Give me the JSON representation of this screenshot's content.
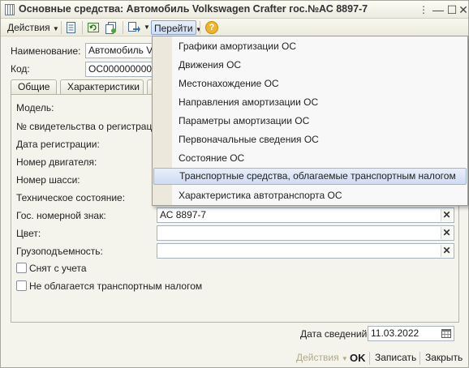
{
  "window": {
    "title": "Основные средства: Автомобиль Volkswagen Crafter гос.№АС 8897-7",
    "minimize": "—",
    "maximize": "☐",
    "close": "✕"
  },
  "toolbar": {
    "actions_label": "Действия",
    "goto_label": "Перейти",
    "help_icon": "?"
  },
  "header": {
    "name_label": "Наименование:",
    "name_value": "Автомобиль Vo",
    "code_label": "Код:",
    "code_value": "ОС00000000007"
  },
  "tabs": [
    "Общие",
    "Характеристики"
  ],
  "form": {
    "model_label": "Модель:",
    "certificate_label": "№ свидетельства о регистрации",
    "reg_date_label": "Дата регистрации:",
    "engine_label": "Номер двигателя:",
    "chassis_label": "Номер шасси:",
    "condition_label": "Техническое состояние:",
    "plate_label": "Гос. номерной знак:",
    "plate_value": "АС 8897-7",
    "color_label": "Цвет:",
    "color_value": "",
    "capacity_label": "Грузоподъемность:",
    "capacity_value": "",
    "deregistered_label": "Снят с учета",
    "no_tax_label": "Не облагается транспортным налогом",
    "clear_symbol": "✕"
  },
  "info_date": {
    "label": "Дата сведений:",
    "value": "11.03.2022"
  },
  "goto_menu": {
    "items": [
      "Графики амортизации ОС",
      "Движения ОС",
      "Местонахождение ОС",
      "Направления амортизации ОС",
      "Параметры амортизации ОС",
      "Первоначальные сведения ОС",
      "Состояние ОС",
      "Транспортные средства, облагаемые транспортным налогом",
      "Характеристика автотранспорта ОС"
    ],
    "highlighted_index": 7
  },
  "footer": {
    "actions_label": "Действия",
    "ok_label": "OK",
    "save_label": "Записать",
    "close_label": "Закрыть"
  },
  "colors": {
    "accent": "#3a6fb0",
    "window_bg": "#f5f4ec",
    "help_icon_bg": "#f0b429"
  }
}
